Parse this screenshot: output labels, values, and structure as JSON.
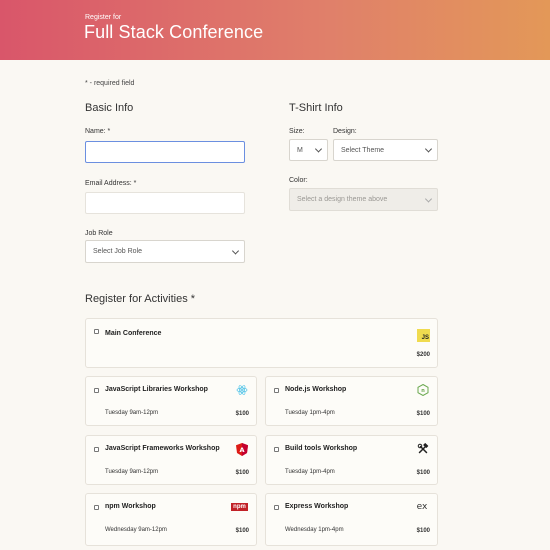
{
  "header": {
    "subtitle": "Register for",
    "title": "Full Stack Conference"
  },
  "required_note": "* - required field",
  "basic_info": {
    "title": "Basic Info",
    "name_label": "Name: *",
    "name_value": "",
    "email_label": "Email Address: *",
    "email_value": "",
    "job_role_label": "Job Role",
    "job_role_selected": "Select Job Role"
  },
  "tshirt": {
    "title": "T-Shirt Info",
    "size_label": "Size:",
    "size_selected": "M",
    "design_label": "Design:",
    "design_selected": "Select Theme",
    "color_label": "Color:",
    "color_selected": "Select a design theme above"
  },
  "activities": {
    "title": "Register for Activities *",
    "items": [
      {
        "name": "Main Conference",
        "time": "",
        "price": "$200",
        "icon": "js-icon"
      },
      {
        "name": "JavaScript Libraries Workshop",
        "time": "Tuesday 9am-12pm",
        "price": "$100",
        "icon": "react-icon"
      },
      {
        "name": "Node.js Workshop",
        "time": "Tuesday 1pm-4pm",
        "price": "$100",
        "icon": "nodejs-icon"
      },
      {
        "name": "JavaScript Frameworks Workshop",
        "time": "Tuesday 9am-12pm",
        "price": "$100",
        "icon": "angular-icon"
      },
      {
        "name": "Build tools Workshop",
        "time": "Tuesday 1pm-4pm",
        "price": "$100",
        "icon": "tools-icon"
      },
      {
        "name": "npm Workshop",
        "time": "Wednesday 9am-12pm",
        "price": "$100",
        "icon": "npm-icon"
      },
      {
        "name": "Express Workshop",
        "time": "Wednesday 1pm-4pm",
        "price": "$100",
        "icon": "express-icon"
      }
    ],
    "icon_text": {
      "js": "JS",
      "npm": "npm",
      "express": "ex"
    }
  },
  "colors": {
    "header_start": "#d9566a",
    "header_end": "#e39858",
    "focus_border": "#6b8fe0",
    "js_yellow": "#f0db4f",
    "angular_red": "#dd1b16",
    "react_blue": "#4fc3e8",
    "node_green": "#6aa84f",
    "npm_red": "#c12127"
  }
}
